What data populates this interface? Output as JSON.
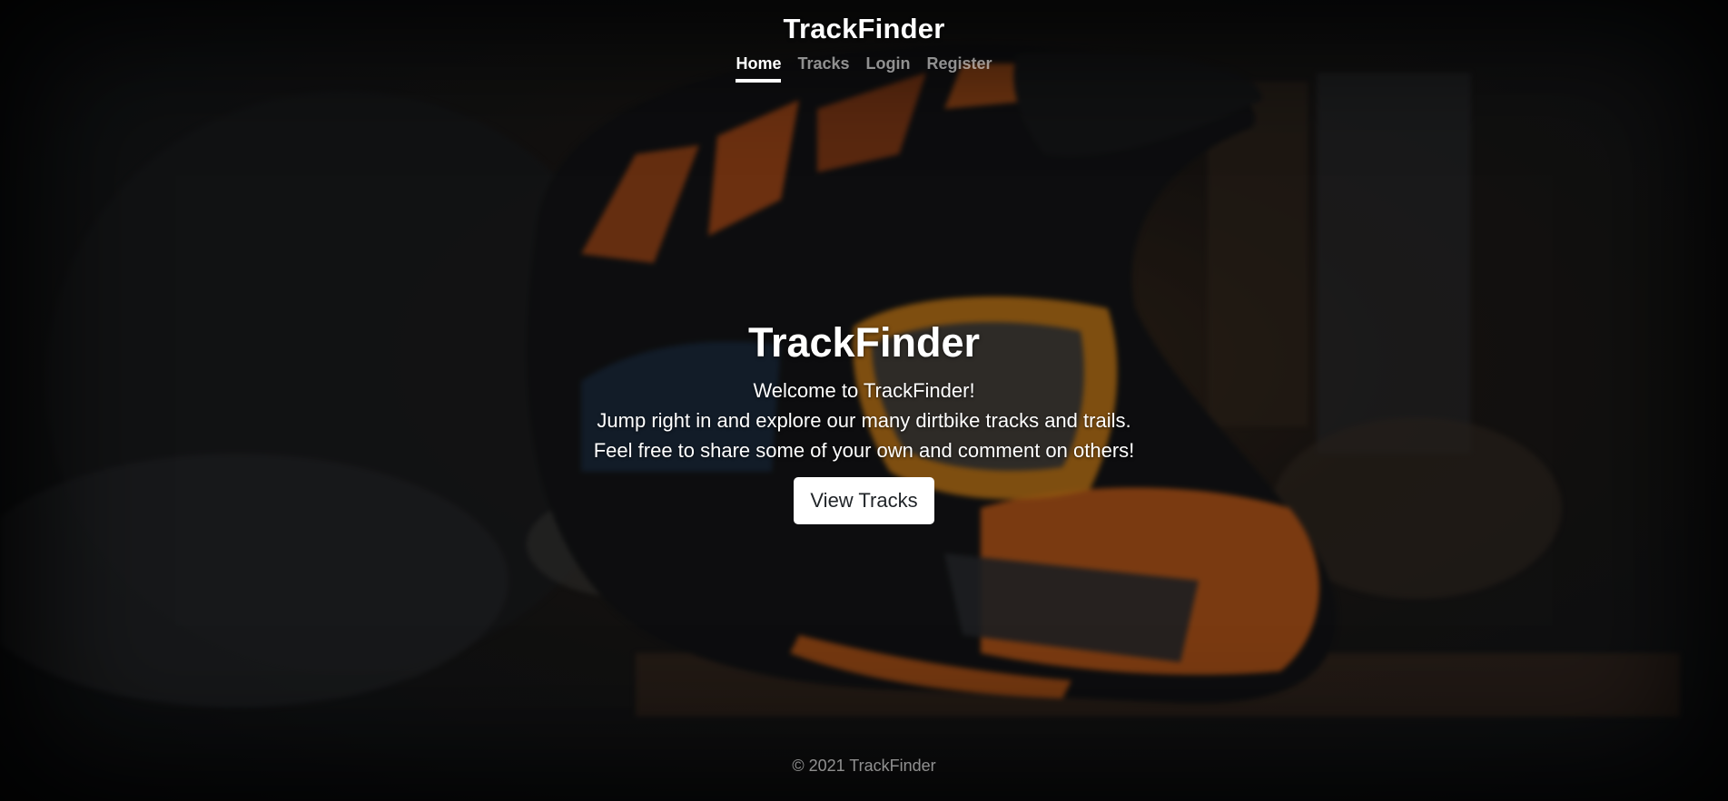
{
  "header": {
    "brand": "TrackFinder",
    "nav": [
      {
        "label": "Home",
        "active": true
      },
      {
        "label": "Tracks",
        "active": false
      },
      {
        "label": "Login",
        "active": false
      },
      {
        "label": "Register",
        "active": false
      }
    ]
  },
  "hero": {
    "title": "TrackFinder",
    "lines": [
      "Welcome to TrackFinder!",
      "Jump right in and explore our many dirtbike tracks and trails.",
      "Feel free to share some of your own and comment on others!"
    ],
    "button_label": "View Tracks"
  },
  "footer": {
    "text": "© 2021 TrackFinder"
  },
  "colors": {
    "button_bg": "#ffffff",
    "helmet_orange": "#d9661c",
    "nav_muted": "rgba(255,255,255,0.55)"
  }
}
